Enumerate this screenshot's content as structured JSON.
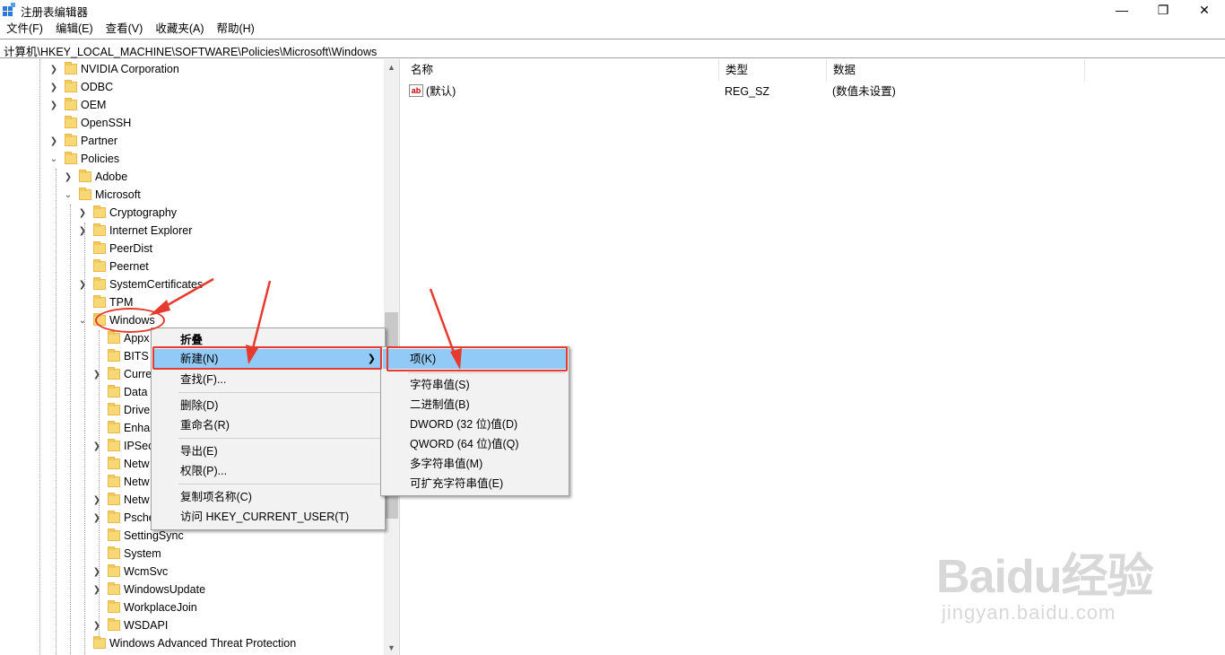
{
  "window": {
    "title": "注册表编辑器",
    "minimize_icon": "minimize-icon",
    "maximize_icon": "maximize-icon",
    "close_icon": "close-icon"
  },
  "menu": [
    "文件(F)",
    "编辑(E)",
    "查看(V)",
    "收藏夹(A)",
    "帮助(H)"
  ],
  "address": "计算机\\HKEY_LOCAL_MACHINE\\SOFTWARE\\Policies\\Microsoft\\Windows",
  "tree": [
    {
      "label": "NVIDIA Corporation",
      "expander": "collapsed"
    },
    {
      "label": "ODBC",
      "expander": "collapsed"
    },
    {
      "label": "OEM",
      "expander": "collapsed"
    },
    {
      "label": "OpenSSH",
      "expander": "none"
    },
    {
      "label": "Partner",
      "expander": "collapsed"
    },
    {
      "label": "Policies",
      "expander": "expanded"
    },
    {
      "label": "Adobe",
      "expander": "collapsed"
    },
    {
      "label": "Microsoft",
      "expander": "expanded"
    },
    {
      "label": "Cryptography",
      "expander": "collapsed"
    },
    {
      "label": "Internet Explorer",
      "expander": "collapsed"
    },
    {
      "label": "PeerDist",
      "expander": "none"
    },
    {
      "label": "Peernet",
      "expander": "none"
    },
    {
      "label": "SystemCertificates",
      "expander": "collapsed"
    },
    {
      "label": "TPM",
      "expander": "none"
    },
    {
      "label": "Windows",
      "expander": "expanded"
    },
    {
      "label": "Appx",
      "expander": "none"
    },
    {
      "label": "BITS",
      "expander": "none"
    },
    {
      "label": "Curre",
      "expander": "collapsed"
    },
    {
      "label": "Data",
      "expander": "none"
    },
    {
      "label": "Drive",
      "expander": "none"
    },
    {
      "label": "Enha",
      "expander": "none"
    },
    {
      "label": "IPSec",
      "expander": "collapsed"
    },
    {
      "label": "Netw",
      "expander": "none"
    },
    {
      "label": "Netw",
      "expander": "none"
    },
    {
      "label": "Netw",
      "expander": "collapsed"
    },
    {
      "label": "Psche",
      "expander": "collapsed"
    },
    {
      "label": "SettingSync",
      "expander": "none"
    },
    {
      "label": "System",
      "expander": "none"
    },
    {
      "label": "WcmSvc",
      "expander": "collapsed"
    },
    {
      "label": "WindowsUpdate",
      "expander": "collapsed"
    },
    {
      "label": "WorkplaceJoin",
      "expander": "none"
    },
    {
      "label": "WSDAPI",
      "expander": "collapsed"
    },
    {
      "label": "Windows Advanced Threat Protection",
      "expander": "none"
    }
  ],
  "list": {
    "headers": [
      "名称",
      "类型",
      "数据"
    ],
    "rows": [
      {
        "name": "(默认)",
        "type": "REG_SZ",
        "data": "(数值未设置)"
      }
    ]
  },
  "context_menu": {
    "items": [
      "折叠",
      "新建(N)",
      "查找(F)...",
      "删除(D)",
      "重命名(R)",
      "导出(E)",
      "权限(P)...",
      "复制项名称(C)",
      "访问 HKEY_CURRENT_USER(T)"
    ]
  },
  "submenu": {
    "items": [
      "项(K)",
      "字符串值(S)",
      "二进制值(B)",
      "DWORD (32 位)值(D)",
      "QWORD (64 位)值(Q)",
      "多字符串值(M)",
      "可扩充字符串值(E)"
    ]
  },
  "watermark": {
    "main": "Baidu经验",
    "sub": "jingyan.baidu.com"
  },
  "colors": {
    "highlight": "#91c9f7",
    "annotation": "#e63a2e",
    "folder": "#f8d775"
  }
}
